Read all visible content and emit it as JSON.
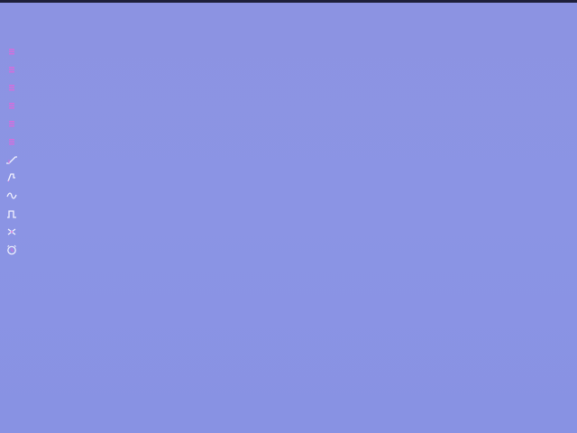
{
  "colors": {
    "background": "#8b93e3",
    "top_bar": "#1e1f3a",
    "menu_icon": "#d86cdc",
    "wave_icon": "#f4f4ff"
  },
  "toolbar": {
    "items": [
      {
        "icon": "menu-icon"
      },
      {
        "icon": "menu-icon"
      },
      {
        "icon": "menu-icon"
      },
      {
        "icon": "menu-icon"
      },
      {
        "icon": "menu-icon"
      },
      {
        "icon": "menu-icon"
      },
      {
        "icon": "sawtooth-wave-icon"
      },
      {
        "icon": "envelope-wave-icon"
      },
      {
        "icon": "sine-wave-icon"
      },
      {
        "icon": "square-wave-icon"
      },
      {
        "icon": "shuffle-icon"
      },
      {
        "icon": "alarm-icon"
      }
    ]
  }
}
